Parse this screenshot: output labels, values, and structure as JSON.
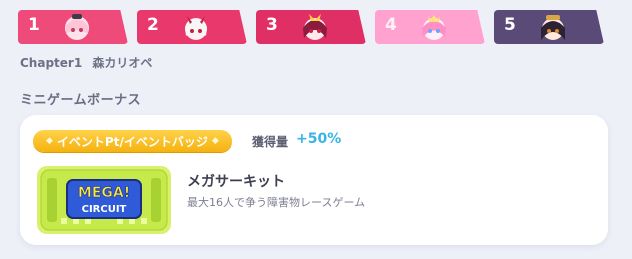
{
  "chapter_tabs": [
    {
      "number": "1",
      "color": "#ee4578",
      "active": true
    },
    {
      "number": "2",
      "color": "#e8386c",
      "active": true
    },
    {
      "number": "3",
      "color": "#df2f64",
      "active": true
    },
    {
      "number": "4",
      "color": "#ff99cc",
      "active": false
    },
    {
      "number": "5",
      "color": "#5a4a78",
      "active": true
    }
  ],
  "chapter": {
    "label": "Chapter1",
    "name": "森カリオペ"
  },
  "section_title": "ミニゲームボーナス",
  "bonus": {
    "badge_label": "イベントPt/イベントバッジ",
    "gain_label": "獲得量",
    "gain_value": "+50%"
  },
  "game": {
    "logo_text_top": "MEGA!",
    "logo_text_bottom": "CIRCUIT",
    "name": "メガサーキット",
    "description": "最大16人で争う障害物レースゲーム"
  }
}
